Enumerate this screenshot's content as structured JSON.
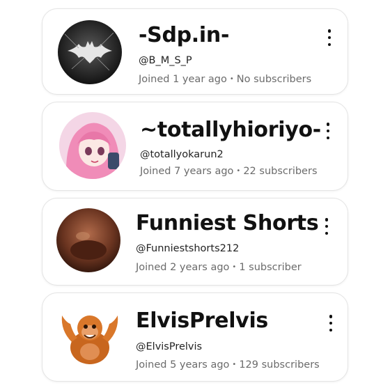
{
  "channels": [
    {
      "name": "-Sdp.in-",
      "handle": "@B_M_S_P",
      "joined": "Joined 1 year ago",
      "subscribers": "No subscribers",
      "avatar_icon": "bat-emblem-icon"
    },
    {
      "name": "~totallyhioriyo-",
      "handle": "@totallyokarun2",
      "joined": "Joined 7 years ago",
      "subscribers": "22 subscribers",
      "avatar_icon": "anime-girl-avatar"
    },
    {
      "name": "Funniest Shorts",
      "handle": "@Funniestshorts212",
      "joined": "Joined 2 years ago",
      "subscribers": "1 subscriber",
      "avatar_icon": "closeup-face-avatar"
    },
    {
      "name": "ElvisPrelvis",
      "handle": "@ElvisPrelvis",
      "joined": "Joined 5 years ago",
      "subscribers": "129 subscribers",
      "avatar_icon": "orangutan-avatar"
    }
  ],
  "more_icon": "more-vertical-icon",
  "separator": "•"
}
